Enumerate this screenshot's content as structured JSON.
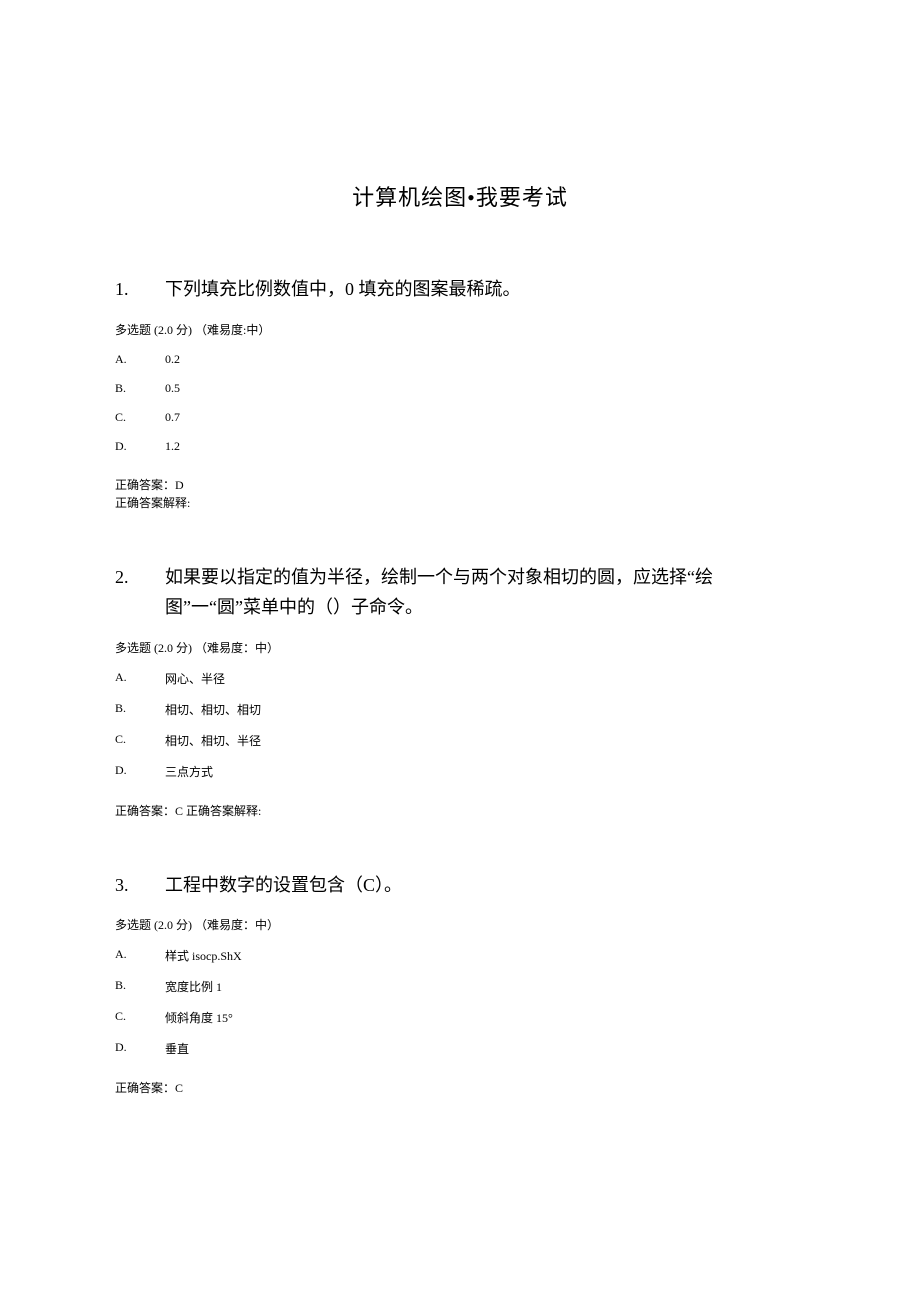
{
  "page_title": "计算机绘图•我要考试",
  "questions": [
    {
      "number": "1.",
      "text": "下列填充比例数值中，0 填充的图案最稀疏。",
      "meta": "多选题 (2.0 分) （难易度:中）",
      "options": [
        {
          "letter": "A.",
          "text": "0.2"
        },
        {
          "letter": "B.",
          "text": "0.5"
        },
        {
          "letter": "C.",
          "text": "0.7"
        },
        {
          "letter": "D.",
          "text": "1.2"
        }
      ],
      "answer_line1": "正确答案：D",
      "answer_line2": "正确答案解释:",
      "answer_mode": "two-lines"
    },
    {
      "number": "2.",
      "text": "如果要以指定的值为半径，绘制一个与两个对象相切的圆，应选择“绘图”一“圆”菜单中的（）子命令。",
      "meta": "多选题 (2.0 分) （难易度：中）",
      "options": [
        {
          "letter": "A.",
          "text": "网心、半径"
        },
        {
          "letter": "B.",
          "text": "相切、相切、相切"
        },
        {
          "letter": "C.",
          "text": "相切、相切、半径"
        },
        {
          "letter": "D.",
          "text": "三点方式"
        }
      ],
      "answer_line1": "正确答案：C 正确答案解释:",
      "answer_line2": "",
      "answer_mode": "one-line"
    },
    {
      "number": "3.",
      "text": "工程中数字的设置包含（C）。",
      "meta": "多选题 (2.0 分) （难易度：中）",
      "options": [
        {
          "letter": "A.",
          "text": "样式 isocp.ShX"
        },
        {
          "letter": "B.",
          "text": "宽度比例 1"
        },
        {
          "letter": "C.",
          "text": "倾斜角度 15°"
        },
        {
          "letter": "D.",
          "text": "垂直"
        }
      ],
      "answer_line1": "正确答案：C",
      "answer_line2": "",
      "answer_mode": "one-line"
    }
  ]
}
